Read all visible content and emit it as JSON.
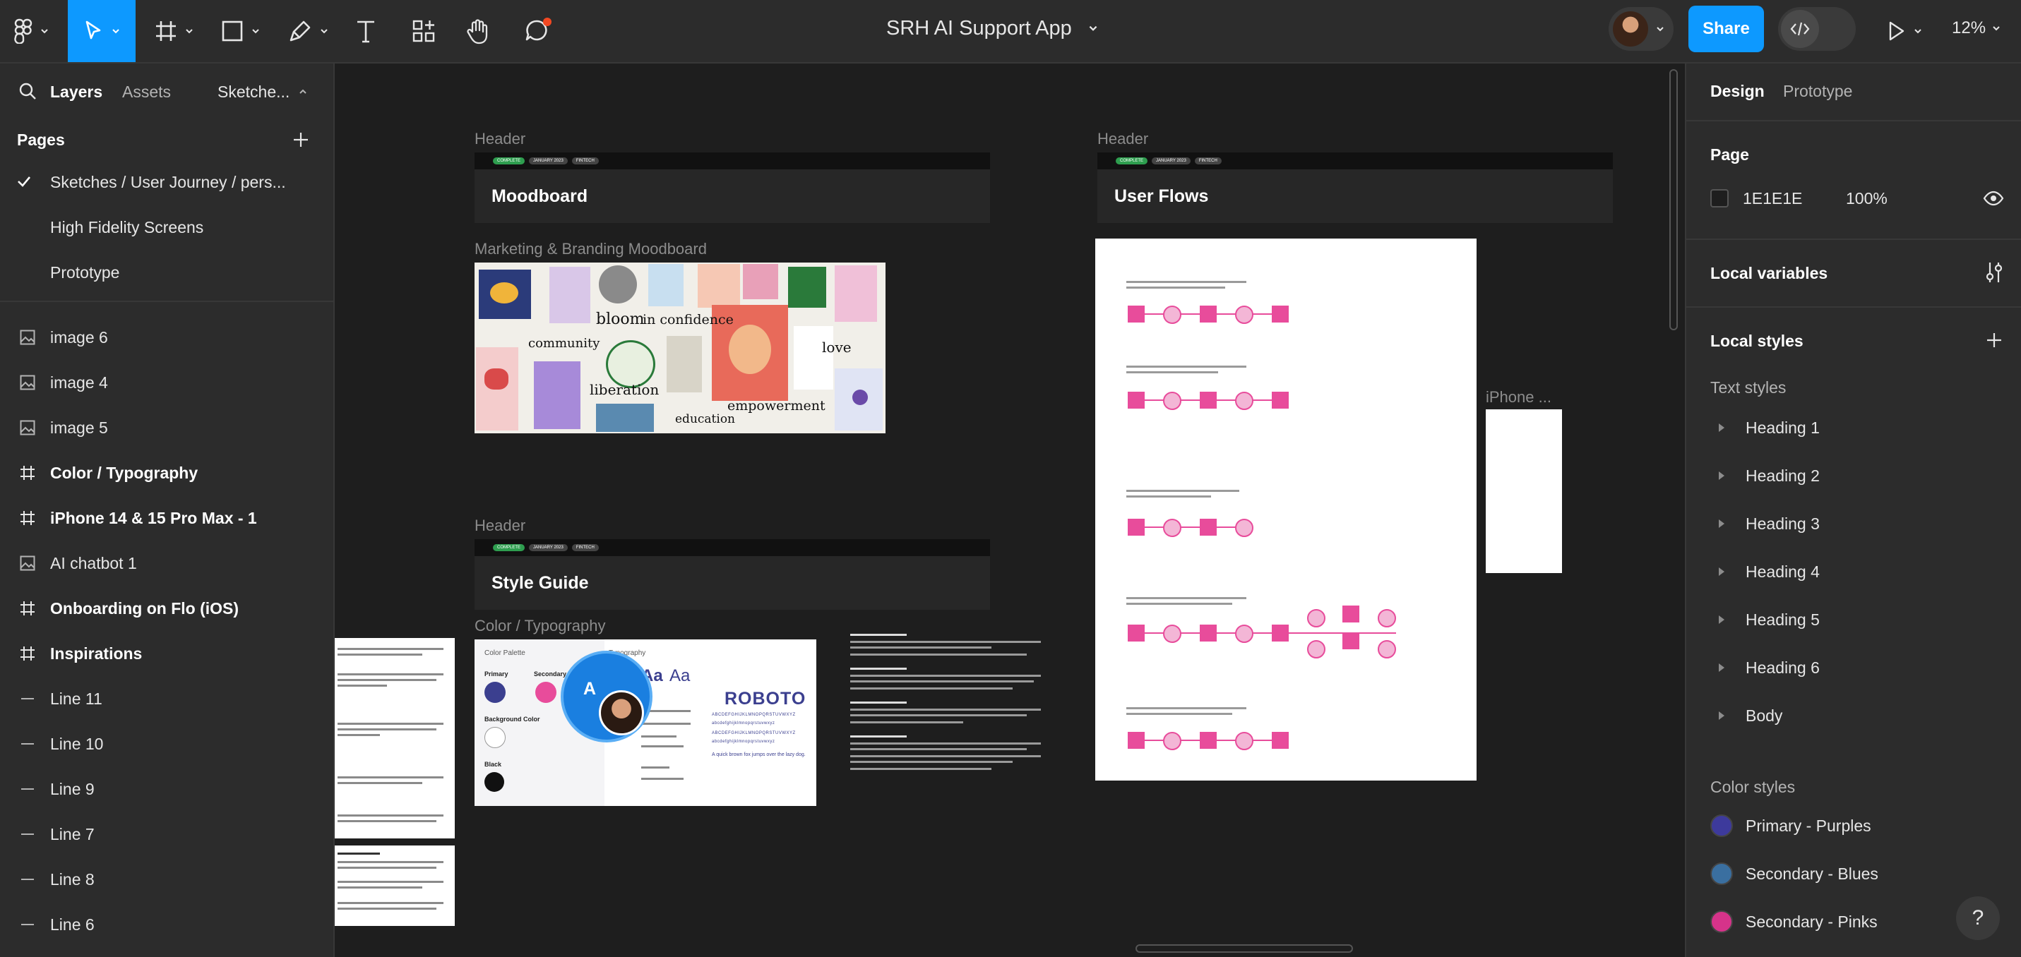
{
  "toolbar": {
    "file_title": "SRH AI Support App",
    "share_label": "Share",
    "zoom_level": "12%",
    "accent_color": "#0d99ff"
  },
  "left_panel": {
    "tabs": {
      "layers": "Layers",
      "assets": "Assets",
      "current_page": "Sketche..."
    },
    "pages_heading": "Pages",
    "pages": [
      {
        "label": "Sketches  / User Journey / pers...",
        "selected": true
      },
      {
        "label": "High Fidelity Screens",
        "selected": false
      },
      {
        "label": "Prototype",
        "selected": false
      }
    ],
    "layers": [
      {
        "label": "image 6",
        "icon": "image-icon"
      },
      {
        "label": "image 4",
        "icon": "image-icon"
      },
      {
        "label": "image 5",
        "icon": "image-icon"
      },
      {
        "label": "Color / Typography",
        "icon": "frame-icon"
      },
      {
        "label": "iPhone 14 & 15 Pro Max - 1",
        "icon": "frame-icon"
      },
      {
        "label": "AI chatbot 1",
        "icon": "image-icon"
      },
      {
        "label": "Onboarding on Flo (iOS)",
        "icon": "frame-icon"
      },
      {
        "label": "Inspirations",
        "icon": "frame-icon"
      },
      {
        "label": "Line 11",
        "icon": "line-icon"
      },
      {
        "label": "Line 10",
        "icon": "line-icon"
      },
      {
        "label": "Line 9",
        "icon": "line-icon"
      },
      {
        "label": "Line 7",
        "icon": "line-icon"
      },
      {
        "label": "Line 8",
        "icon": "line-icon"
      },
      {
        "label": "Line 6",
        "icon": "line-icon"
      }
    ]
  },
  "canvas": {
    "labels": {
      "header_1": "Header",
      "header_2": "Header",
      "header_3": "Header",
      "moodboard_label": "Marketing & Branding Moodboard",
      "color_typo_label": "Color / Typography",
      "iphone_label": "iPhone ..."
    },
    "header_pills": [
      "COMPLETE",
      "JANUARY 2023",
      "FINTECH"
    ],
    "titles": {
      "moodboard": "Moodboard",
      "user_flows": "User Flows",
      "style_guide": "Style Guide"
    },
    "moodboard_words": {
      "bloom": "bloom",
      "in_confidence": "in confidence",
      "community": "community",
      "liberation": "liberation",
      "love": "love",
      "empowerment": "empowerment",
      "education": "education"
    },
    "style_card": {
      "color_palette": "Color Palette",
      "primary": "Primary",
      "secondary": "Secondary",
      "background_color": "Background Color",
      "black": "Black",
      "typography": "Typography",
      "font_name": "ROBOTO",
      "alphabet_upper": "ABCDEFGHIJKLMNOPQRSTUVWXYZ",
      "alphabet_lower": "abcdefghijklmnopqrstuvwxyz",
      "sample_sentence": "A quick brown fox jumps over the lazy dog.",
      "aa1": "Aa",
      "aa2": "Aa",
      "primary_color": "#3b3f8f",
      "secondary_color": "#e84c9b"
    },
    "collaborator_initial": "A"
  },
  "right_panel": {
    "tabs": {
      "design": "Design",
      "prototype": "Prototype"
    },
    "page_heading": "Page",
    "page_color": "1E1E1E",
    "page_opacity": "100%",
    "local_variables": "Local variables",
    "local_styles": "Local styles",
    "text_styles_heading": "Text styles",
    "text_styles": [
      "Heading 1",
      "Heading 2",
      "Heading 3",
      "Heading 4",
      "Heading 5",
      "Heading 6",
      "Body"
    ],
    "color_styles_heading": "Color styles",
    "color_styles": [
      {
        "label": "Primary - Purples",
        "color": "#3d3a9c"
      },
      {
        "label": "Secondary - Blues",
        "color": "#3a6fa0"
      },
      {
        "label": "Secondary - Pinks",
        "color": "#d6338a"
      }
    ]
  },
  "help_label": "?"
}
